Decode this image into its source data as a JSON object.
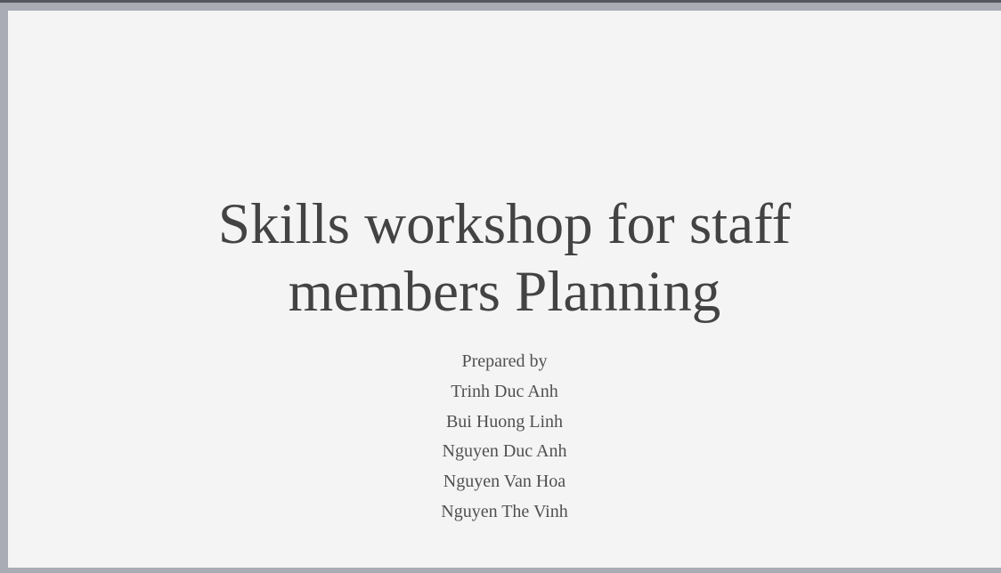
{
  "slide": {
    "title_lines": [
      "Skills workshop for staff",
      "members Planning"
    ],
    "prepared_by_label": "Prepared by",
    "authors": [
      "Trinh Duc Anh",
      "Bui Huong Linh",
      "Nguyen Duc Anh",
      "Nguyen Van Hoa",
      "Nguyen The Vinh"
    ]
  }
}
